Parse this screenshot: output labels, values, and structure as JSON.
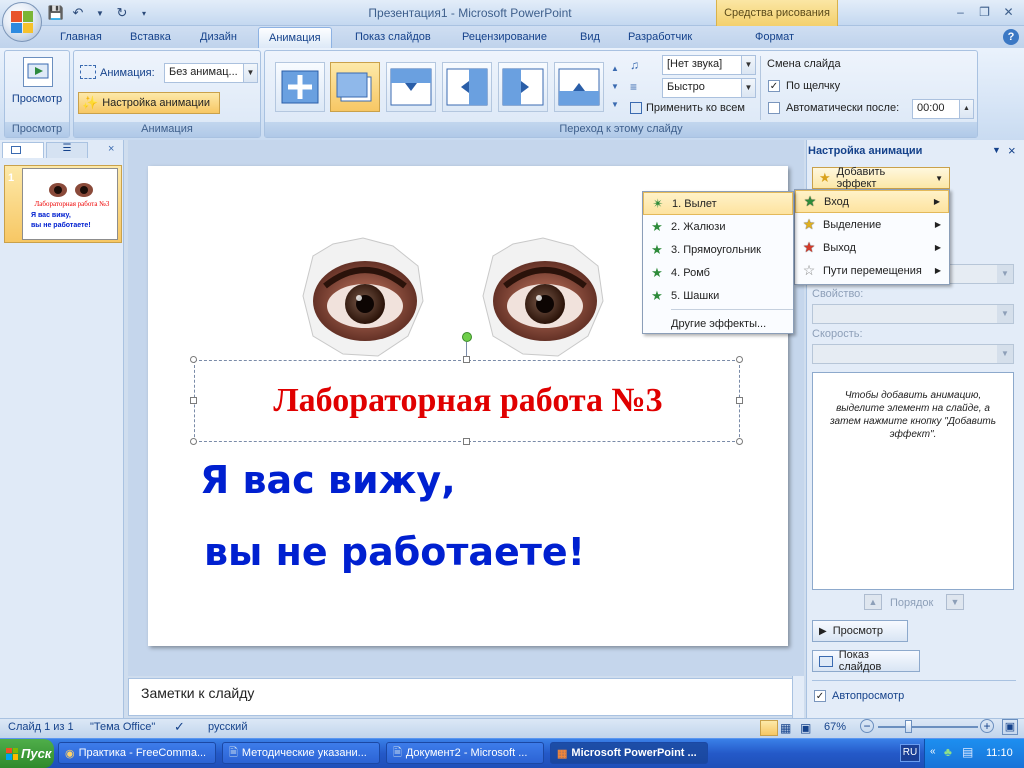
{
  "window": {
    "title": "Презентация1 - Microsoft PowerPoint",
    "contextual_tab": "Средства рисования"
  },
  "tabs": [
    "Главная",
    "Вставка",
    "Дизайн",
    "Анимация",
    "Показ слайдов",
    "Рецензирование",
    "Вид",
    "Разработчик",
    "Формат"
  ],
  "active_tab": "Анимация",
  "ribbon": {
    "preview_label": "Просмотр",
    "preview_group": "Просмотр",
    "animation_label": "Анимация:",
    "animation_value": "Без анимац...",
    "custom_animation": "Настройка анимации",
    "animation_group": "Анимация",
    "sound_value": "[Нет звука]",
    "speed_value": "Быстро",
    "apply_all": "Применить ко всем",
    "transition_group": "Переход к этому слайду",
    "advance_title": "Смена слайда",
    "on_click": "По щелчку",
    "auto_after": "Автоматически после:",
    "auto_time": "00:00"
  },
  "thumbnails": {
    "slide_number": "1",
    "thumb_title": "Лабораторная работа №3",
    "thumb_line1": "Я вас вижу,",
    "thumb_line2": "вы не работаете!"
  },
  "slide": {
    "title": "Лабораторная работа №3",
    "line1": "Я вас вижу,",
    "line2": "вы не работаете!"
  },
  "notes": "Заметки к слайду",
  "task_pane": {
    "title": "Настройка анимации",
    "add_effect": "Добавить эффект",
    "property_label": "Свойство:",
    "speed_label": "Скорость:",
    "hint": "Чтобы добавить анимацию, выделите элемент на слайде, а затем нажмите кнопку \"Добавить эффект\".",
    "order_label": "Порядок",
    "play_button": "Просмотр",
    "slideshow_button": "Показ слайдов",
    "autopreview": "Автопросмотр"
  },
  "effect_menu": [
    {
      "label": "Вход",
      "color": "#2e8b3a"
    },
    {
      "label": "Выделение",
      "color": "#e0b020"
    },
    {
      "label": "Выход",
      "color": "#d43a2a"
    },
    {
      "label": "Пути перемещения",
      "color": "#ffffff"
    }
  ],
  "entrance_menu": {
    "items": [
      "1. Вылет",
      "2. Жалюзи",
      "3. Прямоугольник",
      "4. Ромб",
      "5. Шашки"
    ],
    "more": "Другие эффекты..."
  },
  "status": {
    "slide": "Слайд 1 из 1",
    "theme": "\"Тема Office\"",
    "language": "русский",
    "zoom": "67%"
  },
  "taskbar": {
    "start": "Пуск",
    "items": [
      "Практика - FreeComma...",
      "Методические указани...",
      "Документ2 - Microsoft ...",
      "Microsoft PowerPoint ..."
    ],
    "lang": "RU",
    "clock": "11:10"
  }
}
